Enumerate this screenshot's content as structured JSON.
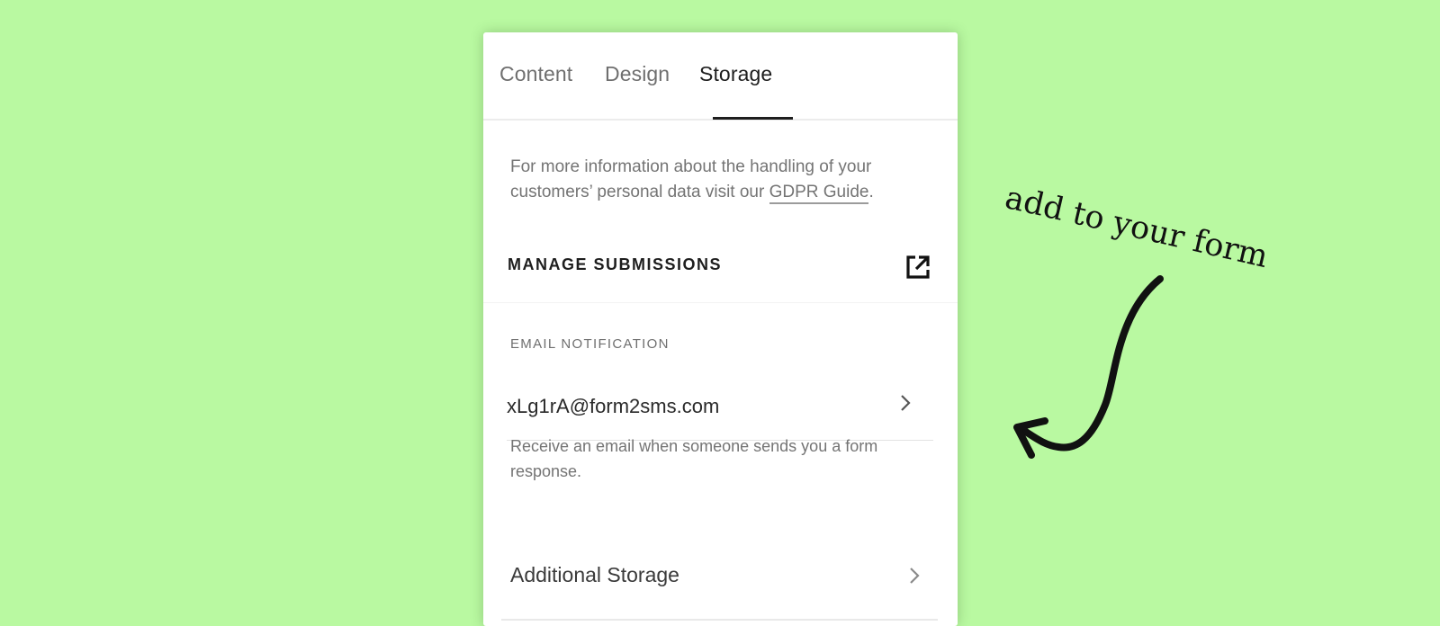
{
  "tabs": [
    {
      "label": "Content",
      "active": false
    },
    {
      "label": "Design",
      "active": false
    },
    {
      "label": "Storage",
      "active": true
    }
  ],
  "info": {
    "text": "For more information about the handling of your customers’ personal data visit our ",
    "link_label": "GDPR Guide",
    "suffix": "."
  },
  "manage": {
    "label": "MANAGE SUBMISSIONS",
    "icon": "external-link-icon"
  },
  "email_notification": {
    "heading": "EMAIL NOTIFICATION",
    "value": "xLg1rA@form2sms.com",
    "help": "Receive an email when someone sends you a form response."
  },
  "additional_storage": {
    "label": "Additional Storage"
  },
  "annotation": {
    "text": "add to your form"
  },
  "colors": {
    "background": "#b9f9a1",
    "panel": "#ffffff",
    "text_primary": "#1e1e1e",
    "text_secondary": "#747474",
    "annotation": "#111111"
  }
}
